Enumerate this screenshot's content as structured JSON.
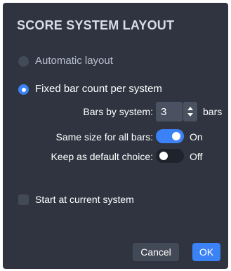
{
  "dialog": {
    "title": "SCORE SYSTEM LAYOUT",
    "options": {
      "automatic_label": "Automatic layout",
      "fixed_label": "Fixed bar count per system",
      "selected": "fixed"
    },
    "bars_by_system": {
      "label": "Bars by system:",
      "value": "3",
      "unit": "bars"
    },
    "same_size": {
      "label": "Same size for all bars:",
      "state_text": "On",
      "enabled": true
    },
    "keep_default": {
      "label": "Keep as default choice:",
      "state_text": "Off",
      "enabled": false
    },
    "start_current": {
      "label": "Start at current system",
      "checked": false
    },
    "buttons": {
      "cancel": "Cancel",
      "ok": "OK"
    }
  },
  "colors": {
    "background": "#2f3440",
    "accent": "#3b82f6",
    "control": "#434a57",
    "title": "#d6dcea"
  }
}
